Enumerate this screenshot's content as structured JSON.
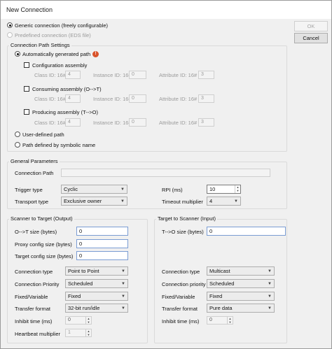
{
  "window": {
    "title": "New Connection"
  },
  "buttons": {
    "ok": "OK",
    "cancel": "Cancel"
  },
  "connection_type": {
    "generic": "Generic connection (freely configurable)",
    "predefined": "Predefined connection (EDS file)"
  },
  "path_settings": {
    "group_label": "Connection Path Settings",
    "auto_path": "Automatically generated path",
    "info_glyph": "!",
    "assemblies": [
      {
        "label": "Configuration assembly",
        "class_label": "Class ID: 16#",
        "class_val": "4",
        "instance_label": "Instance ID: 16#",
        "instance_val": "0",
        "attribute_label": "Attribute ID: 16#",
        "attribute_val": "3"
      },
      {
        "label": "Consuming assembly (O-->T)",
        "class_label": "Class ID: 16#",
        "class_val": "4",
        "instance_label": "Instance ID: 16#",
        "instance_val": "0",
        "attribute_label": "Attribute ID: 16#",
        "attribute_val": "3"
      },
      {
        "label": "Producing assembly (T-->O)",
        "class_label": "Class ID: 16#",
        "class_val": "4",
        "instance_label": "Instance ID: 16#",
        "instance_val": "0",
        "attribute_label": "Attribute ID: 16#",
        "attribute_val": "3"
      }
    ],
    "user_defined": "User-defined path",
    "symbolic": "Path defined by symbolic name"
  },
  "general": {
    "group_label": "General Parameters",
    "connection_path_label": "Connection Path",
    "connection_path_value": "",
    "trigger_label": "Trigger type",
    "trigger_value": "Cyclic",
    "transport_label": "Transport type",
    "transport_value": "Exclusive owner",
    "rpi_label": "RPI (ms)",
    "rpi_value": "10",
    "timeout_label": "Timeout multiplier",
    "timeout_value": "4"
  },
  "output": {
    "group_label": "Scanner to Target (Output)",
    "size_label": "O-->T size (bytes)",
    "size_value": "0",
    "proxy_label": "Proxy config size (bytes)",
    "proxy_value": "0",
    "target_label": "Target config size (bytes)",
    "target_value": "0",
    "conn_type_label": "Connection type",
    "conn_type_value": "Point to Point",
    "priority_label": "Connection Priority",
    "priority_value": "Scheduled",
    "fixed_label": "Fixed/Variable",
    "fixed_value": "Fixed",
    "format_label": "Transfer format",
    "format_value": "32-bit run/idle",
    "inhibit_label": "Inhibit time (ms)",
    "inhibit_value": "0",
    "heartbeat_label": "Heartbeat multiplier",
    "heartbeat_value": "1"
  },
  "input": {
    "group_label": "Target to Scanner (Input)",
    "size_label": "T-->O size (bytes)",
    "size_value": "0",
    "conn_type_label": "Connection type",
    "conn_type_value": "Multicast",
    "priority_label": "Connection priority",
    "priority_value": "Scheduled",
    "fixed_label": "Fixed/Variable",
    "fixed_value": "Fixed",
    "format_label": "Transfer format",
    "format_value": "Pure data",
    "inhibit_label": "Inhibit time (ms)",
    "inhibit_value": "0"
  },
  "glyphs": {
    "dropdown": "▼",
    "spin_up": "▲",
    "spin_down": "▼"
  }
}
